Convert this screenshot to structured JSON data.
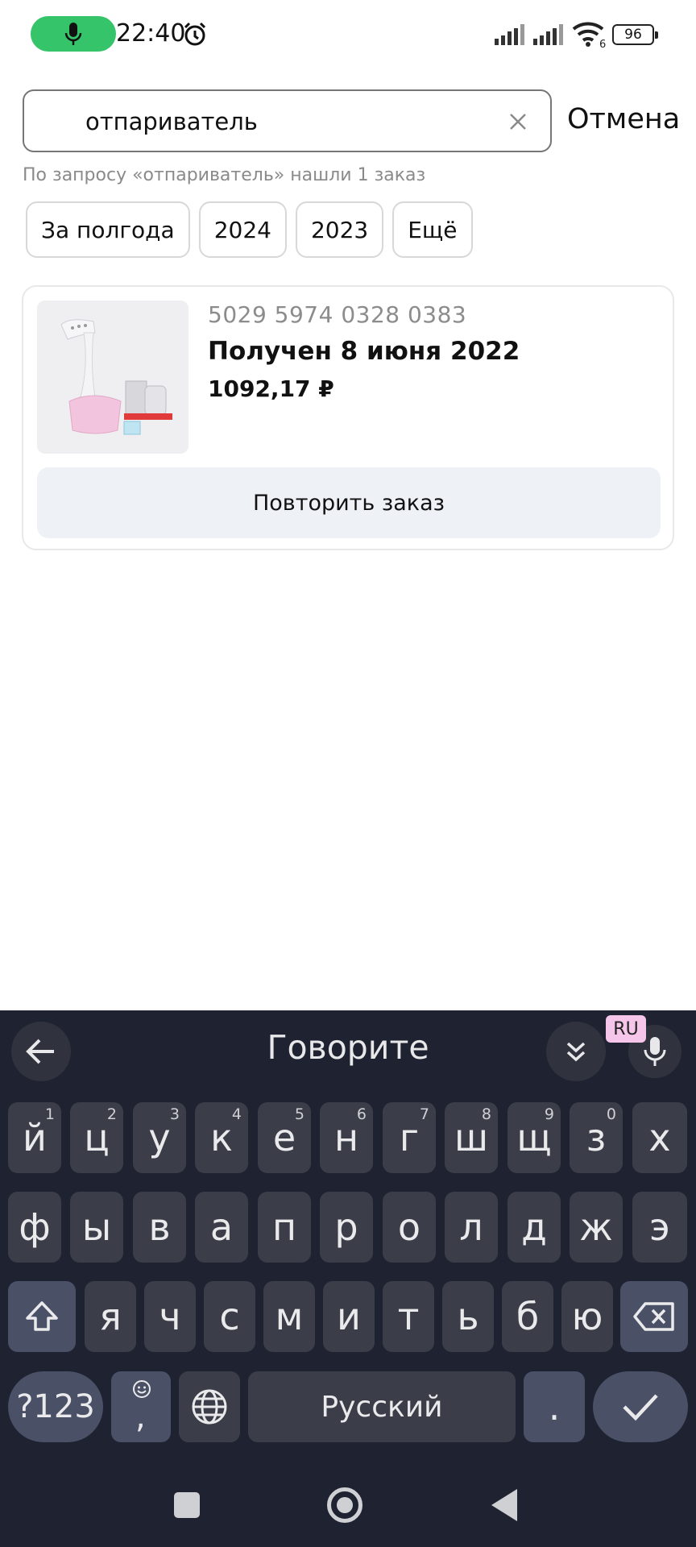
{
  "status_bar": {
    "time": "22:40",
    "battery": "96",
    "wifi_badge": "6",
    "mic_color": "#35c46a"
  },
  "search": {
    "value": "отпариватель",
    "placeholder": "",
    "cancel_label": "Отмена",
    "results_note": "По запросу «отпариватель» нашли 1 заказ"
  },
  "filters": {
    "chips": [
      "За полгода",
      "2024",
      "2023",
      "Ещё"
    ]
  },
  "order": {
    "number": "5029 5974 0328 0383",
    "status": "Получен 8 июня 2022",
    "price": "1092,17 ₽",
    "repeat_label": "Повторить заказ"
  },
  "keyboard": {
    "speak_label": "Говорите",
    "lang_badge": "RU",
    "row1": [
      "й",
      "ц",
      "у",
      "к",
      "е",
      "н",
      "г",
      "ш",
      "щ",
      "з",
      "х"
    ],
    "row1_hints": [
      "1",
      "2",
      "3",
      "4",
      "5",
      "6",
      "7",
      "8",
      "9",
      "0",
      ""
    ],
    "row2": [
      "ф",
      "ы",
      "в",
      "а",
      "п",
      "р",
      "о",
      "л",
      "д",
      "ж",
      "э"
    ],
    "row3": [
      "я",
      "ч",
      "с",
      "м",
      "и",
      "т",
      "ь",
      "б",
      "ю"
    ],
    "symbols_label": "?123",
    "comma_label": ",",
    "space_label": "Русский",
    "period_label": ".",
    "background": "#1f2331"
  }
}
